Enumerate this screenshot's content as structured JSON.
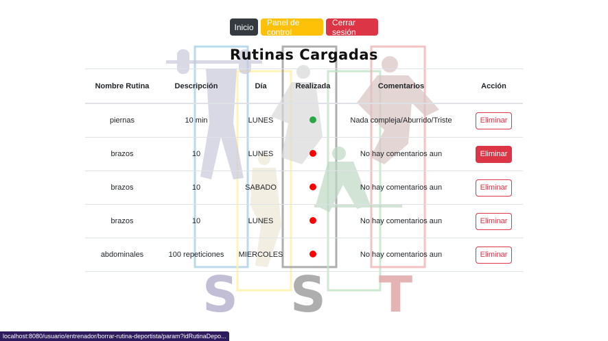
{
  "nav": {
    "inicio": "Inicio",
    "panel": "Panel de control",
    "logout": "Cerrar sesión"
  },
  "title": "Rutinas Cargadas",
  "table": {
    "headers": [
      "Nombre Rutina",
      "Descripción",
      "Día",
      "Realizada",
      "Comentarios",
      "Acción"
    ],
    "rows": [
      {
        "nombre": "piernas",
        "descripcion": "10 min",
        "dia": "LUNES",
        "realizada": true,
        "comentarios": "Nada compleja/Aburrido/Triste",
        "accion": "Eliminar"
      },
      {
        "nombre": "brazos",
        "descripcion": "10",
        "dia": "LUNES",
        "realizada": false,
        "comentarios": "No hay comentarios aun",
        "accion": "Eliminar"
      },
      {
        "nombre": "brazos",
        "descripcion": "10",
        "dia": "SABADO",
        "realizada": false,
        "comentarios": "No hay comentarios aun",
        "accion": "Eliminar"
      },
      {
        "nombre": "brazos",
        "descripcion": "10",
        "dia": "LUNES",
        "realizada": false,
        "comentarios": "No hay comentarios aun",
        "accion": "Eliminar"
      },
      {
        "nombre": "abdominales",
        "descripcion": "100 repeticiones",
        "dia": "MIERCOLES",
        "realizada": false,
        "comentarios": "No hay comentarios aun",
        "accion": "Eliminar"
      }
    ]
  },
  "status_url": "localhost:8080/usuario/entrenador/borrar-rutina-deportista/param?idRutinaDepo...",
  "colors": {
    "done": "#28a745",
    "not_done": "#ff0000",
    "danger": "#dc3545",
    "warning": "#ffc107",
    "dark": "#343a40"
  }
}
